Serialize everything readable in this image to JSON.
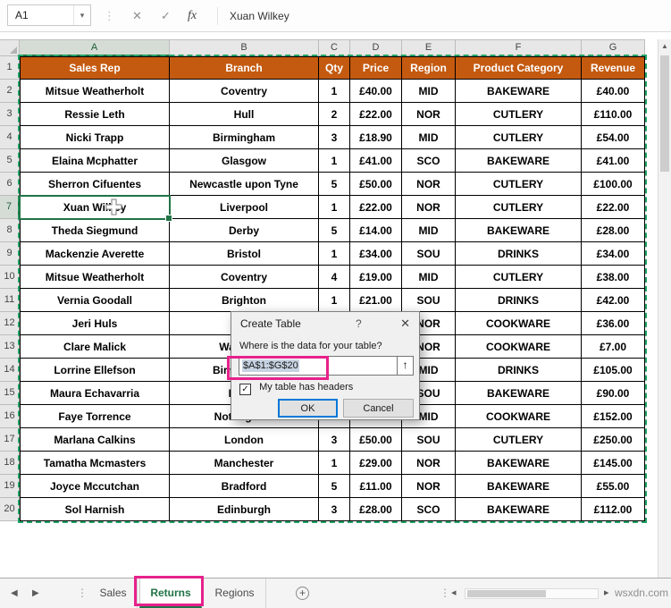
{
  "formula_bar": {
    "name_box_value": "A1",
    "dropdown_icon": "▾",
    "cancel_icon": "✕",
    "enter_icon": "✓",
    "fx_icon": "fx",
    "formula_text": "Xuan Wilkey"
  },
  "sheet": {
    "col_letters": [
      "A",
      "B",
      "C",
      "D",
      "E",
      "F",
      "G"
    ],
    "row_numbers": [
      1,
      2,
      3,
      4,
      5,
      6,
      7,
      8,
      9,
      10,
      11,
      12,
      13,
      14,
      15,
      16,
      17,
      18,
      19,
      20
    ]
  },
  "table": {
    "headers": [
      "Sales Rep",
      "Branch",
      "Qty",
      "Price",
      "Region",
      "Product Category",
      "Revenue"
    ],
    "rows": [
      [
        "Mitsue Weatherholt",
        "Coventry",
        "1",
        "£40.00",
        "MID",
        "BAKEWARE",
        "£40.00"
      ],
      [
        "Ressie Leth",
        "Hull",
        "2",
        "£22.00",
        "NOR",
        "CUTLERY",
        "£110.00"
      ],
      [
        "Nicki Trapp",
        "Birmingham",
        "3",
        "£18.90",
        "MID",
        "CUTLERY",
        "£54.00"
      ],
      [
        "Elaina Mcphatter",
        "Glasgow",
        "1",
        "£41.00",
        "SCO",
        "BAKEWARE",
        "£41.00"
      ],
      [
        "Sherron Cifuentes",
        "Newcastle upon Tyne",
        "5",
        "£50.00",
        "NOR",
        "CUTLERY",
        "£100.00"
      ],
      [
        "Xuan Wilkey",
        "Liverpool",
        "1",
        "£22.00",
        "NOR",
        "CUTLERY",
        "£22.00"
      ],
      [
        "Theda Siegmund",
        "Derby",
        "5",
        "£14.00",
        "MID",
        "BAKEWARE",
        "£28.00"
      ],
      [
        "Mackenzie Averette",
        "Bristol",
        "1",
        "£34.00",
        "SOU",
        "DRINKS",
        "£34.00"
      ],
      [
        "Mitsue Weatherholt",
        "Coventry",
        "4",
        "£19.00",
        "MID",
        "CUTLERY",
        "£38.00"
      ],
      [
        "Vernia Goodall",
        "Brighton",
        "1",
        "£21.00",
        "SOU",
        "DRINKS",
        "£42.00"
      ],
      [
        "Jeri Huls",
        "",
        "",
        "",
        "NOR",
        "COOKWARE",
        "£36.00"
      ],
      [
        "Clare Malick",
        "Wakefield",
        "",
        "",
        "NOR",
        "COOKWARE",
        "£7.00"
      ],
      [
        "Lorrine Ellefson",
        "Birmingham",
        "",
        "",
        "MID",
        "DRINKS",
        "£105.00"
      ],
      [
        "Maura Echavarria",
        "Leeds",
        "",
        "",
        "SOU",
        "BAKEWARE",
        "£90.00"
      ],
      [
        "Faye Torrence",
        "Nottingham",
        "",
        "",
        "MID",
        "COOKWARE",
        "£152.00"
      ],
      [
        "Marlana Calkins",
        "London",
        "3",
        "£50.00",
        "SOU",
        "CUTLERY",
        "£250.00"
      ],
      [
        "Tamatha Mcmasters",
        "Manchester",
        "1",
        "£29.00",
        "NOR",
        "BAKEWARE",
        "£145.00"
      ],
      [
        "Joyce Mccutchan",
        "Bradford",
        "5",
        "£11.00",
        "NOR",
        "BAKEWARE",
        "£55.00"
      ],
      [
        "Sol Harnish",
        "Edinburgh",
        "3",
        "£28.00",
        "SCO",
        "BAKEWARE",
        "£112.00"
      ]
    ]
  },
  "dialog": {
    "title": "Create Table",
    "help_icon": "?",
    "close_icon": "✕",
    "prompt": "Where is the data for your table?",
    "range_value": "$A$1:$G$20",
    "picker_icon": "↑",
    "checkbox_label": "My table has headers",
    "checkbox_checked": true,
    "check_icon": "✓",
    "ok_label": "OK",
    "cancel_label": "Cancel"
  },
  "tabs_bar": {
    "nav_left_icon": "◀",
    "nav_right_icon": "▶",
    "dots_icon": "⋮",
    "tabs": [
      "Sales",
      "Returns",
      "Regions"
    ],
    "active_tab": "Returns",
    "add_sheet_icon": "+",
    "hscroll_left_icon": "◂",
    "hscroll_right_icon": "▸",
    "vscroll_up_icon": "▲"
  },
  "watermark": "wsxdn.com",
  "colors": {
    "table_header_fill": "#C45A10",
    "excel_green": "#217346",
    "marching_ants_green": "#21A366",
    "annotation_pink": "#E7218C",
    "ok_focus_border": "#0078D7"
  }
}
